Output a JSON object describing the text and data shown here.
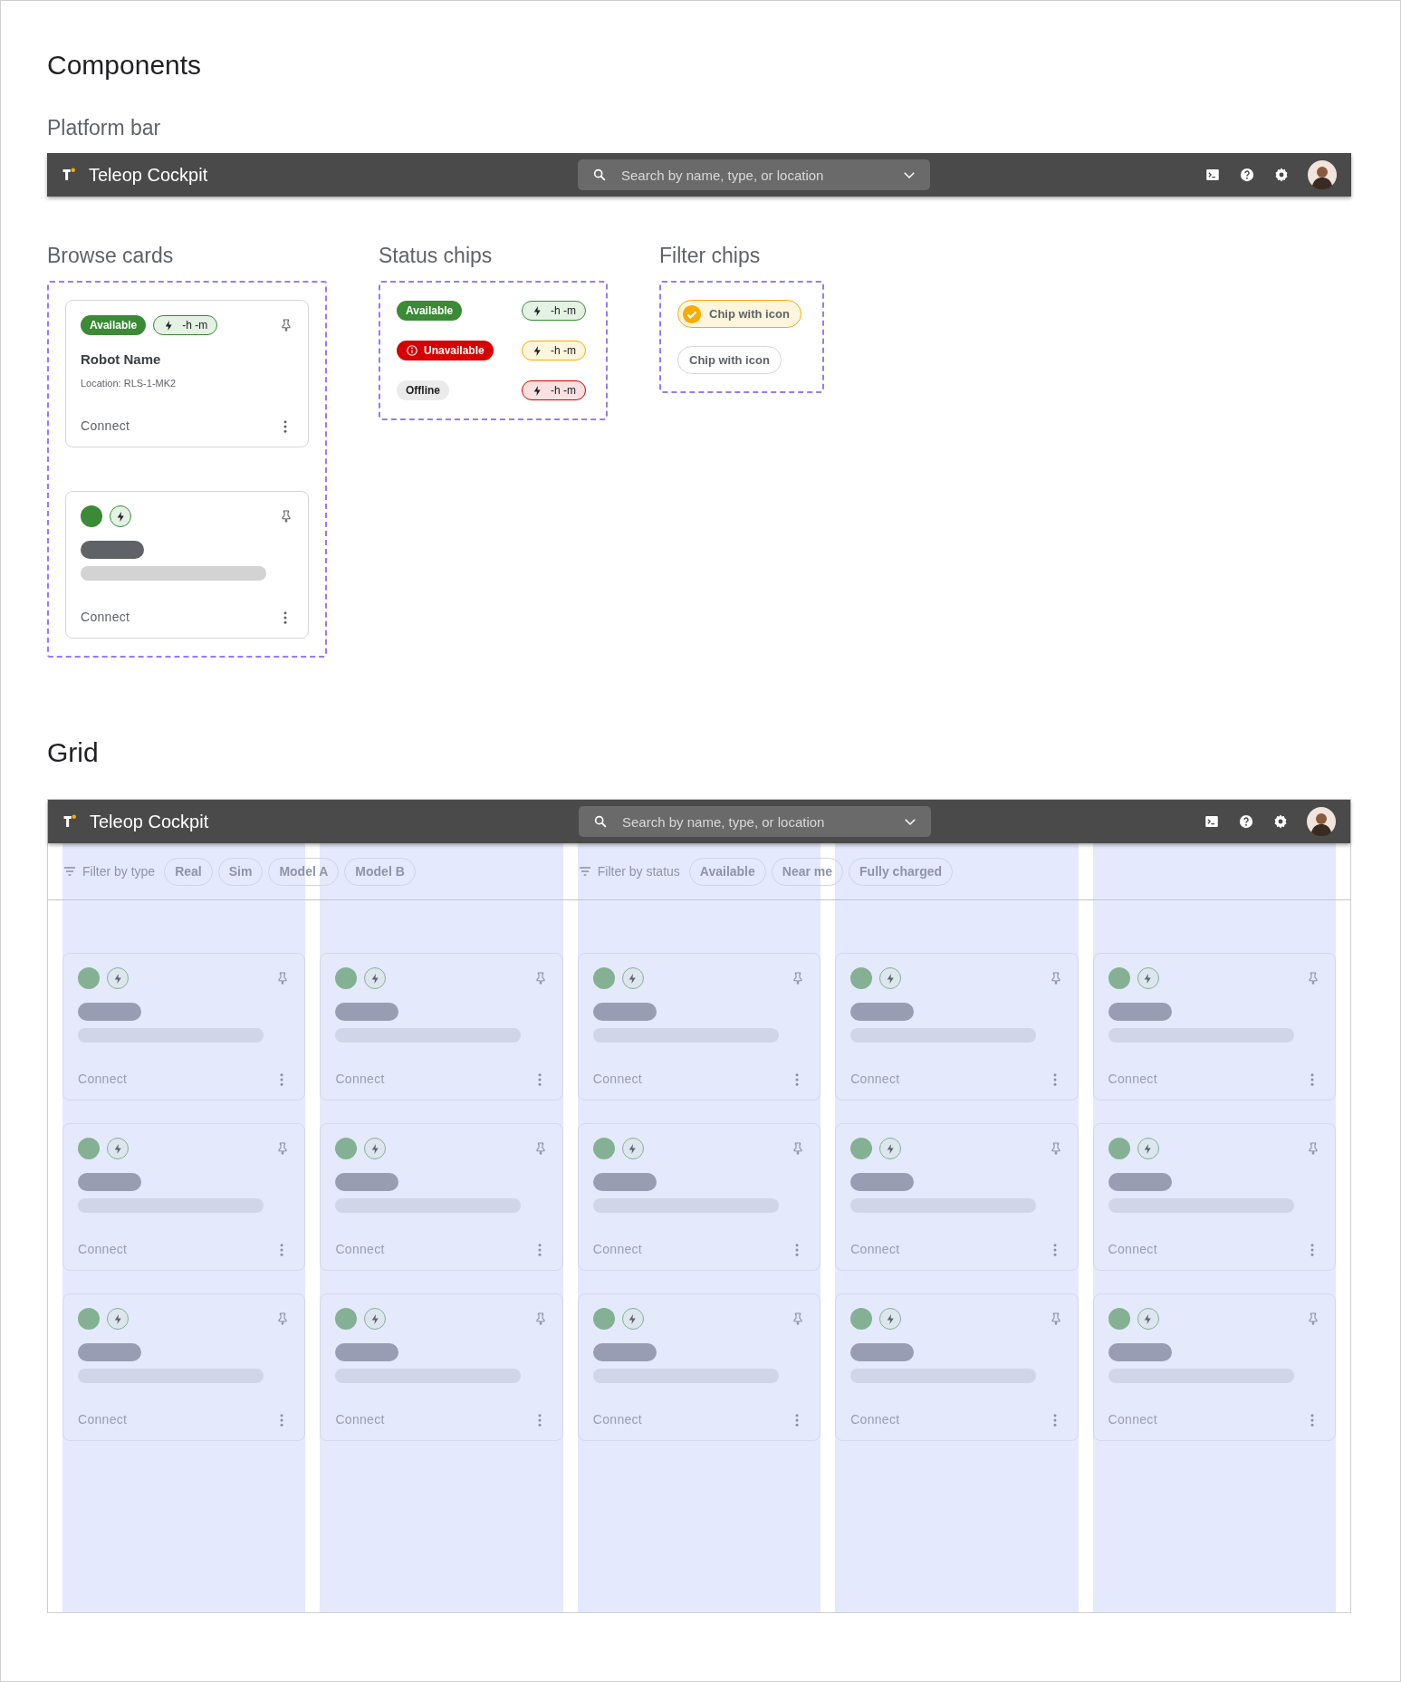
{
  "components": {
    "title": "Components",
    "platform_bar": {
      "heading": "Platform bar",
      "app_title": "Teleop Cockpit",
      "search": {
        "placeholder": "Search by name, type, or location"
      }
    },
    "browse_cards": {
      "heading": "Browse cards",
      "cards": [
        {
          "kind": "detail",
          "status": "Available",
          "battery": "-h -m",
          "name": "Robot Name",
          "location": "Location: RLS-1-MK2",
          "action": "Connect"
        },
        {
          "kind": "skeleton",
          "action": "Connect"
        }
      ]
    },
    "status_chips": {
      "heading": "Status chips",
      "rows": [
        {
          "status": {
            "label": "Available",
            "kind": "available"
          },
          "battery": {
            "label": "-h -m",
            "kind": "good"
          }
        },
        {
          "status": {
            "label": "Unavailable",
            "kind": "unavailable"
          },
          "battery": {
            "label": "-h -m",
            "kind": "medium"
          }
        },
        {
          "status": {
            "label": "Offline",
            "kind": "offline"
          },
          "battery": {
            "label": "-h -m",
            "kind": "low"
          }
        }
      ]
    },
    "filter_chips": {
      "heading": "Filter chips",
      "chips": [
        {
          "label": "Chip with icon",
          "selected": true
        },
        {
          "label": "Chip with icon",
          "selected": false
        }
      ]
    }
  },
  "grid": {
    "title": "Grid",
    "platform_bar": {
      "app_title": "Teleop Cockpit",
      "search": {
        "placeholder": "Search by name, type, or location"
      }
    },
    "filter_groups": [
      {
        "label": "Filter by type",
        "chips": [
          "Real",
          "Sim",
          "Model A",
          "Model B"
        ]
      },
      {
        "label": "Filter by status",
        "chips": [
          "Available",
          "Near me",
          "Fully charged"
        ]
      }
    ],
    "card_rows": [
      [
        {
          "action": "Connect"
        },
        {
          "action": "Connect"
        },
        {
          "action": "Connect"
        },
        {
          "action": "Connect"
        },
        {
          "action": "Connect"
        }
      ],
      [
        {
          "action": "Connect"
        },
        {
          "action": "Connect"
        },
        {
          "action": "Connect"
        },
        {
          "action": "Connect"
        },
        {
          "action": "Connect"
        }
      ],
      [
        {
          "action": "Connect"
        },
        {
          "action": "Connect"
        },
        {
          "action": "Connect"
        },
        {
          "action": "Connect"
        },
        {
          "action": "Connect"
        }
      ]
    ]
  }
}
